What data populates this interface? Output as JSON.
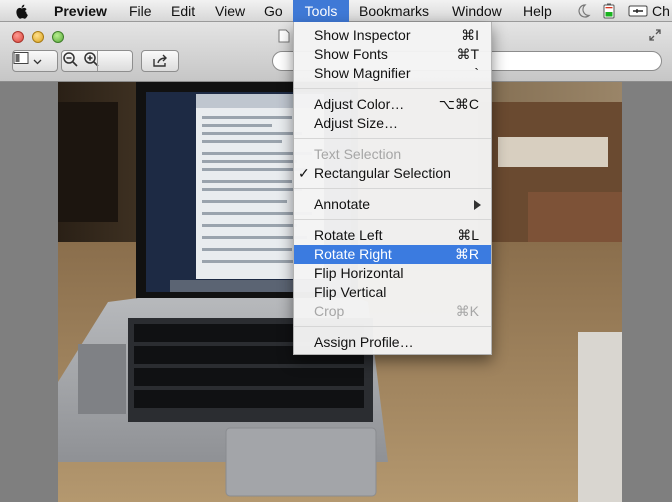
{
  "menubar": {
    "app": "Preview",
    "items": [
      "File",
      "Edit",
      "View",
      "Go",
      "Tools",
      "Bookmarks",
      "Window",
      "Help"
    ],
    "active": "Tools",
    "status_text": "Ch",
    "icons": [
      "apple-logo-icon",
      "moon-icon",
      "battery-icon",
      "power-icon"
    ]
  },
  "toolbar": {
    "icons": [
      "sidebar-icon",
      "chevron-down-icon",
      "zoom-out-icon",
      "zoom-in-icon",
      "share-icon",
      "fullscreen-icon",
      "document-icon"
    ]
  },
  "tools_menu": {
    "items": [
      {
        "label": "Show Inspector",
        "shortcut": "⌘I"
      },
      {
        "label": "Show Fonts",
        "shortcut": "⌘T"
      },
      {
        "label": "Show Magnifier",
        "shortcut": "`"
      },
      {
        "label": "Adjust Color…",
        "shortcut": "⌥⌘C"
      },
      {
        "label": "Adjust Size…",
        "shortcut": ""
      },
      {
        "label": "Text Selection",
        "shortcut": "",
        "disabled": true
      },
      {
        "label": "Rectangular Selection",
        "shortcut": "",
        "checked": true
      },
      {
        "label": "Annotate",
        "shortcut": "",
        "submenu": true
      },
      {
        "label": "Rotate Left",
        "shortcut": "⌘L"
      },
      {
        "label": "Rotate Right",
        "shortcut": "⌘R",
        "highlighted": true
      },
      {
        "label": "Flip Horizontal",
        "shortcut": ""
      },
      {
        "label": "Flip Vertical",
        "shortcut": ""
      },
      {
        "label": "Crop",
        "shortcut": "⌘K",
        "disabled": true
      },
      {
        "label": "Assign Profile…",
        "shortcut": ""
      }
    ],
    "check_mark": "✓"
  },
  "colors": {
    "menu_highlight": "#3b7be0",
    "active_menu_title": "#3f79d6"
  }
}
